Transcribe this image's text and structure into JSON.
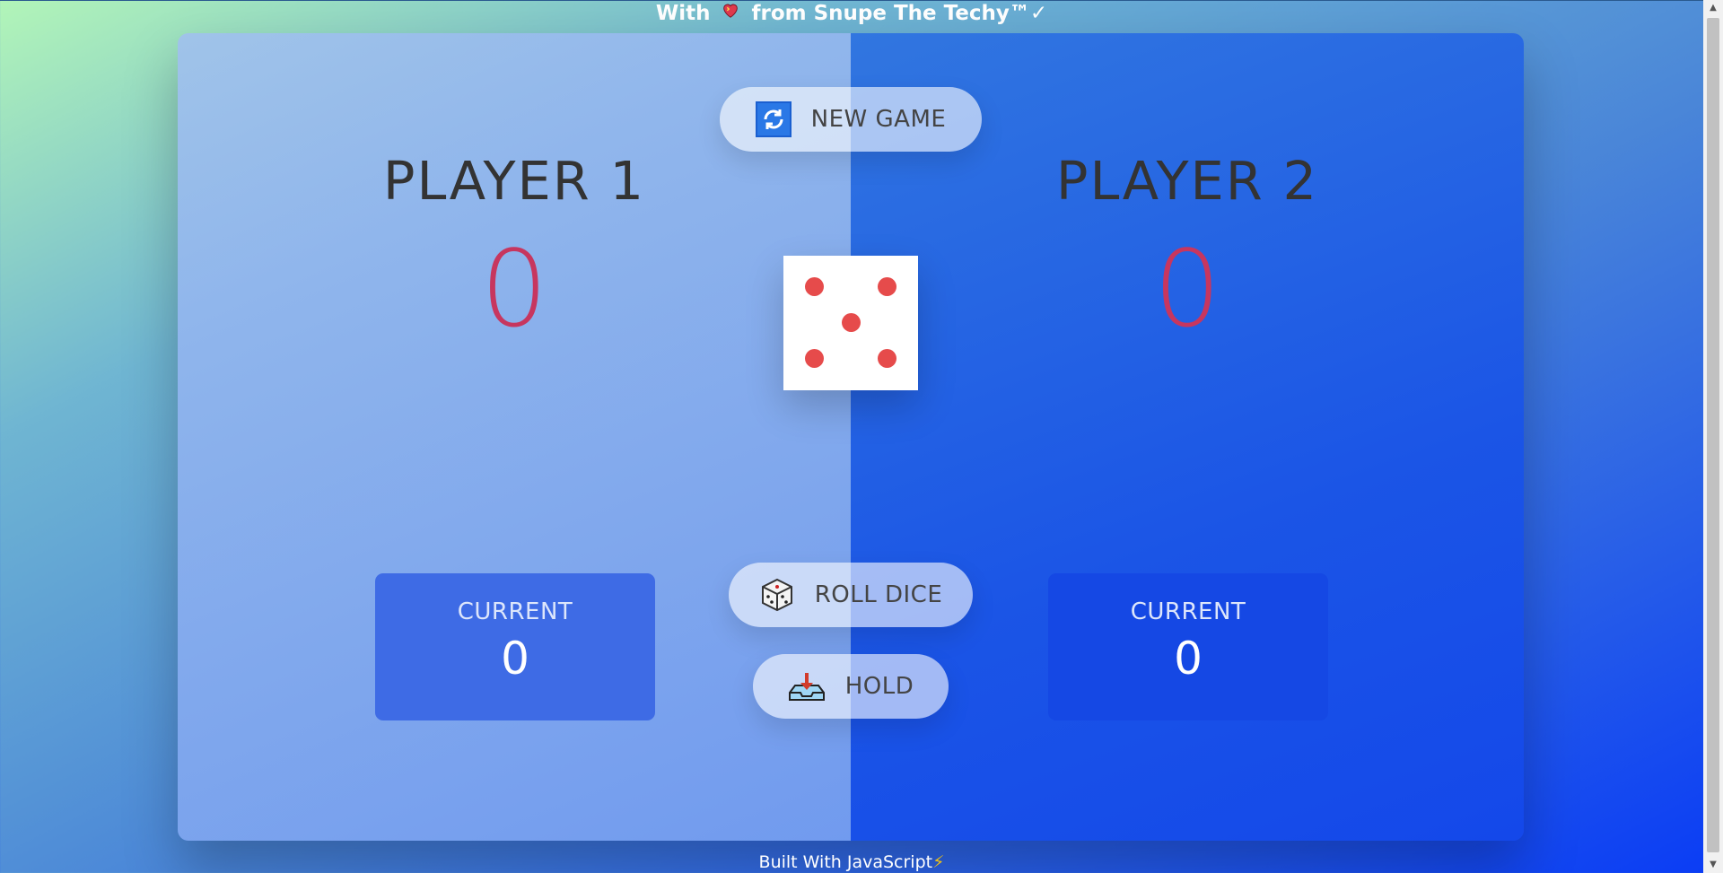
{
  "credit": {
    "prefix": "With",
    "heart_icon": "heart-icon",
    "suffix": "from Snupe The Techy™✓"
  },
  "footer": {
    "text": "Built With JavaScript",
    "bolt": "⚡"
  },
  "players": [
    {
      "name": "PLAYER 1",
      "score": "0",
      "current_label": "CURRENT",
      "current_score": "0",
      "active": true
    },
    {
      "name": "PLAYER 2",
      "score": "0",
      "current_label": "CURRENT",
      "current_score": "0",
      "active": false
    }
  ],
  "buttons": {
    "new_game": {
      "label": "NEW GAME",
      "icon": "refresh-icon"
    },
    "roll_dice": {
      "label": "ROLL DICE",
      "icon": "dice-icon"
    },
    "hold": {
      "label": "HOLD",
      "icon": "download-tray-icon"
    }
  },
  "dice": {
    "value": 5
  },
  "colors": {
    "score": "#c7365f",
    "pip": "#e64b4b",
    "player1_bg": "#8aaeee",
    "player2_bg": "#1b55e6"
  }
}
